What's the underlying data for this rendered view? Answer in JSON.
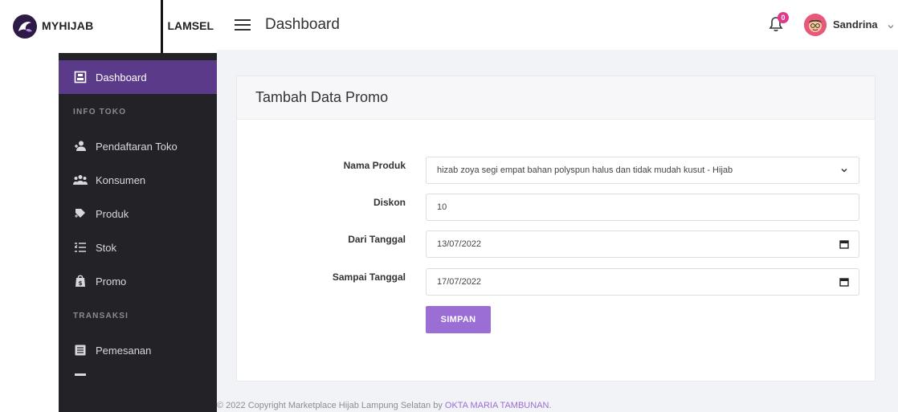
{
  "brand": {
    "name": "MYHIJAB",
    "region": "LAMSEL"
  },
  "topbar": {
    "title": "Dashboard",
    "notification_count": "0",
    "user_name": "Sandrina"
  },
  "sidebar": {
    "items": [
      {
        "label": "Dashboard",
        "icon": "dashboard-icon",
        "active": true
      },
      {
        "section": "INFO TOKO"
      },
      {
        "label": "Pendaftaran Toko",
        "icon": "user-add-icon"
      },
      {
        "label": "Konsumen",
        "icon": "users-icon"
      },
      {
        "label": "Produk",
        "icon": "product-icon"
      },
      {
        "label": "Stok",
        "icon": "stock-list-icon"
      },
      {
        "label": "Promo",
        "icon": "promo-bag-icon"
      },
      {
        "section": "TRANSAKSI"
      },
      {
        "label": "Pemesanan",
        "icon": "order-icon"
      }
    ]
  },
  "card": {
    "title": "Tambah Data Promo",
    "fields": {
      "nama_produk": {
        "label": "Nama Produk",
        "value": "hizab zoya segi empat bahan polyspun halus dan tidak mudah kusut - Hijab"
      },
      "diskon": {
        "label": "Diskon",
        "value": "10"
      },
      "dari_tanggal": {
        "label": "Dari Tanggal",
        "value": "13/07/2022"
      },
      "sampai_tanggal": {
        "label": "Sampai Tanggal",
        "value": "17/07/2022"
      }
    },
    "save_label": "SIMPAN"
  },
  "footer": {
    "text": "© 2022 Copyright Marketplace Hijab Lampung Selatan by ",
    "author": "OKTA MARIA TAMBUNAN",
    "end": "."
  },
  "colors": {
    "sidebar_bg": "#232327",
    "active_item": "#5b3a8a",
    "accent": "#9b6ed6",
    "badge": "#e0388a"
  }
}
